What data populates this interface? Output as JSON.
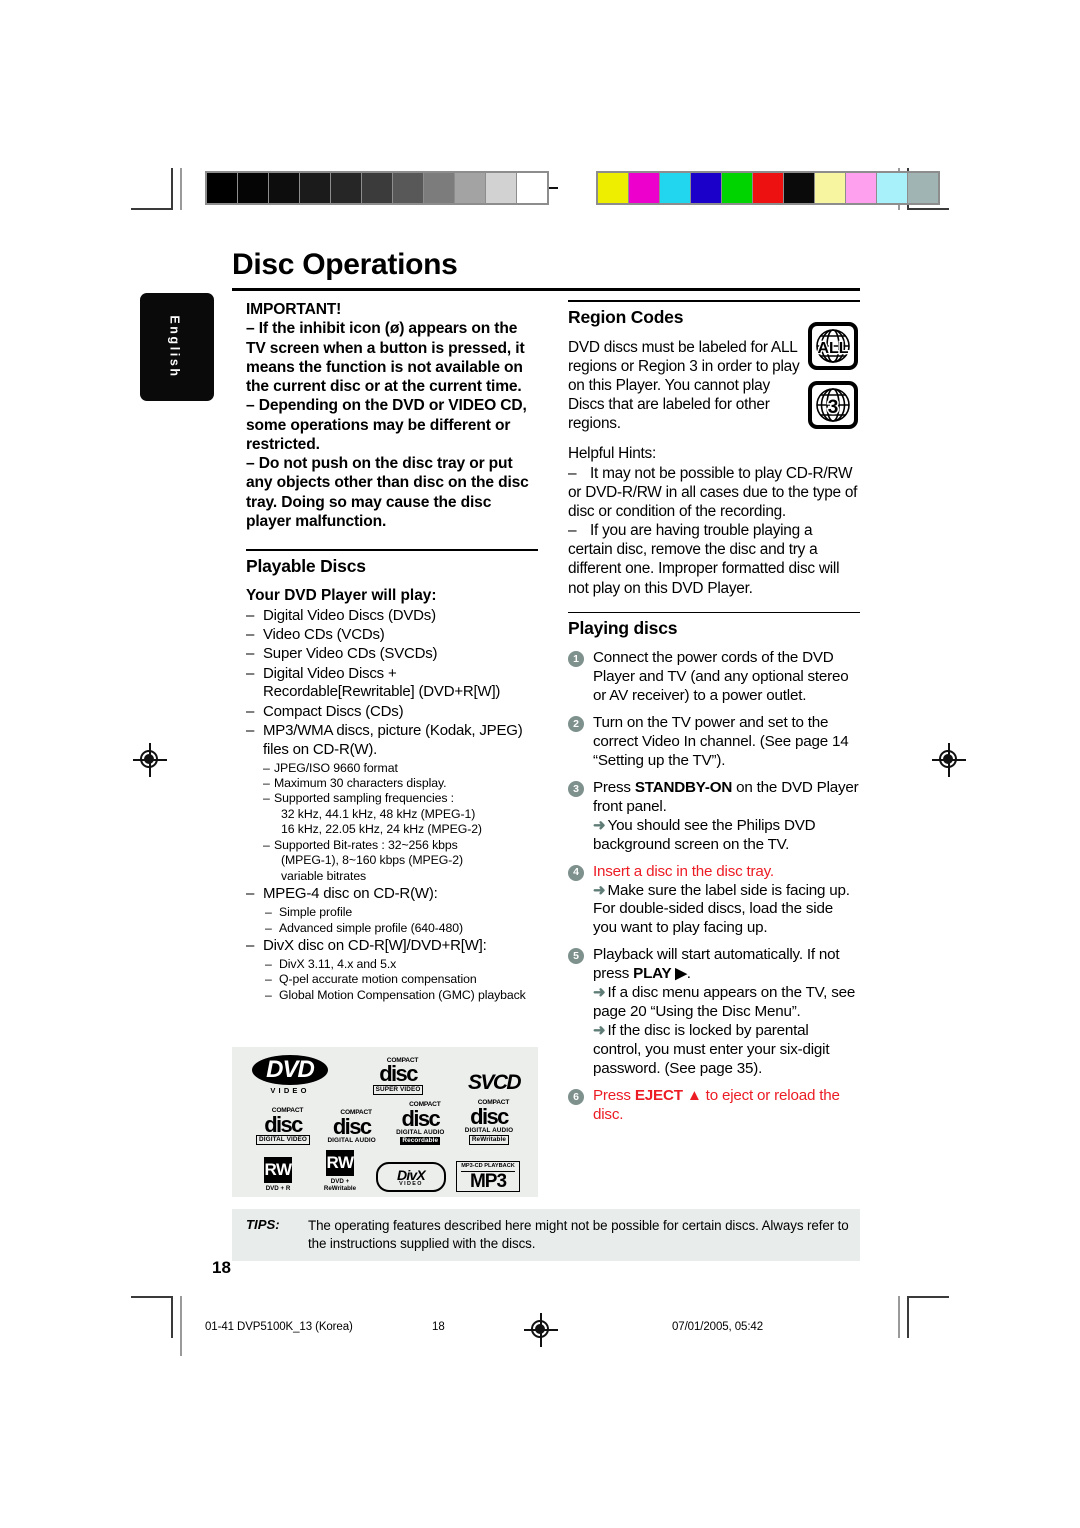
{
  "page": {
    "title": "Disc Operations",
    "number": "18",
    "language_tab": "English"
  },
  "color_bars": {
    "grayscale": [
      "#000000",
      "#050505",
      "#0d0d0d",
      "#1b1b1b",
      "#262626",
      "#3b3b3b",
      "#585858",
      "#7c7c7c",
      "#a3a3a3",
      "#d2d2d2",
      "#ffffff"
    ],
    "color": [
      "#eeee00",
      "#ee00cc",
      "#22d6f0",
      "#1a00c8",
      "#00d400",
      "#ee1111",
      "#0a0a0a",
      "#f7f5a0",
      "#ffa0ee",
      "#a8f0fa",
      "#a0b4b4"
    ]
  },
  "important": {
    "heading": "IMPORTANT!",
    "items": [
      "–  If the inhibit icon (ø) appears on the TV screen when a button is pressed, it means the function is not available on the current disc or at the current time.",
      "–  Depending on the DVD or VIDEO CD, some operations may be different or restricted.",
      "–  Do not push on the disc tray or put any objects other than disc on the disc tray.  Doing so may cause the disc player malfunction."
    ]
  },
  "playable_discs": {
    "heading": "Playable Discs",
    "subheading": "Your DVD Player will play:",
    "items": [
      {
        "text": "Digital Video Discs (DVDs)"
      },
      {
        "text": "Video CDs (VCDs)"
      },
      {
        "text": "Super Video CDs (SVCDs)"
      },
      {
        "text": "Digital Video Discs + Recordable[Rewritable] (DVD+R[W])"
      },
      {
        "text": "Compact Discs (CDs)"
      },
      {
        "text": "MP3/WMA discs, picture (Kodak, JPEG) files on CD-R(W).",
        "sub": [
          "JPEG/ISO 9660 format",
          "Maximum 30 characters display.",
          "Supported sampling frequencies :",
          "32 kHz, 44.1 kHz, 48 kHz (MPEG-1)",
          "16 kHz, 22.05 kHz, 24 kHz (MPEG-2)",
          "Supported Bit-rates : 32~256 kbps",
          "(MPEG-1), 8~160 kbps (MPEG-2)",
          "variable bitrates"
        ]
      },
      {
        "text": "MPEG-4 disc on CD-R(W):",
        "sub2": [
          "Simple profile",
          "Advanced simple profile (640-480)"
        ]
      },
      {
        "text": "DivX disc on CD-R[W]/DVD+R[W]:",
        "sub2": [
          "DivX 3.11, 4.x and 5.x",
          "Q-pel accurate motion compensation",
          "Global Motion Compensation (GMC) playback"
        ]
      }
    ]
  },
  "logos": {
    "dvd_video": {
      "main": "DVD",
      "sub": "VIDEO"
    },
    "cd_super_video": {
      "top": "COMPACT",
      "main": "disc",
      "sub": "SUPER VIDEO"
    },
    "svcd": {
      "main": "SVCD"
    },
    "cd_digital_video": {
      "top": "COMPACT",
      "main": "disc",
      "sub": "DIGITAL VIDEO"
    },
    "cd_digital_audio": {
      "top": "COMPACT",
      "main": "disc",
      "sub": "DIGITAL AUDIO"
    },
    "cd_recordable": {
      "top": "COMPACT",
      "main": "disc",
      "sub": "DIGITAL AUDIO",
      "sub2": "Recordable"
    },
    "cd_rewritable": {
      "top": "COMPACT",
      "main": "disc",
      "sub": "DIGITAL AUDIO",
      "sub2": "ReWritable"
    },
    "dvd_plus_r": {
      "main": "RW",
      "cap": "DVD + R"
    },
    "dvd_plus_rw": {
      "main": "RW",
      "cap": "DVD + ReWritable"
    },
    "divx": {
      "main": "DivX",
      "sub": "VIDEO"
    },
    "mp3": {
      "top": "MP3-CD PLAYBACK",
      "main": "MP3"
    }
  },
  "region_codes": {
    "heading": "Region Codes",
    "body": "DVD discs must be labeled for ALL regions or Region 3 in order to play on this Player. You cannot play Discs that are labeled for other regions.",
    "icon_all": "ALL",
    "icon_region": "3"
  },
  "helpful_hints": {
    "heading": "Helpful Hints:",
    "items": [
      "It may not be possible to play CD-R/RW or DVD-R/RW in all cases due to the type of disc or condition of the recording.",
      "If you are having trouble playing a certain disc, remove the disc and try a different one.  Improper formatted disc will not play on this DVD Player."
    ]
  },
  "playing_discs": {
    "heading": "Playing discs",
    "steps": [
      {
        "n": "1",
        "text": "Connect the power cords of the DVD Player and TV (and any optional stereo or AV receiver) to a power outlet.",
        "red": false,
        "notes": []
      },
      {
        "n": "2",
        "text": "Turn on the TV power and set to the correct Video In channel.  (See page 14 “Setting up the TV”).",
        "red": false,
        "notes": []
      },
      {
        "n": "3",
        "text_pre": "Press ",
        "text_bold": "STANDBY-ON",
        "text_post": " on the DVD Player front panel.",
        "red": false,
        "notes": [
          "You should see the Philips DVD background screen on the TV."
        ]
      },
      {
        "n": "4",
        "text": "Insert a disc in the disc tray.",
        "red": true,
        "notes": [
          "Make sure the label side is facing up. For double-sided discs, load the side you want to play facing up."
        ]
      },
      {
        "n": "5",
        "text_pre": "Playback will start automatically. If not press ",
        "text_bold": "PLAY ▶",
        "text_post": ".",
        "red": false,
        "notes": [
          "If a disc menu appears on the TV, see page 20 “Using the Disc Menu”.",
          "If the disc is locked by parental control, you must enter your six-digit password. (See page 35)."
        ]
      },
      {
        "n": "6",
        "text_pre": "Press ",
        "text_bold": "EJECT ▲",
        "text_post": " to eject or reload the disc.",
        "red": true,
        "notes": []
      }
    ]
  },
  "tips": {
    "label": "TIPS:",
    "text": "The operating features described here might not be possible for certain discs.  Always refer to the instructions supplied with the discs."
  },
  "footer": {
    "left": "01-41 DVP5100K_13 (Korea)",
    "page": "18",
    "right": "07/01/2005, 05:42"
  },
  "colors": {
    "step_badge": "#7e918d",
    "arrow": "#5f7d76",
    "red": "#ec1c24",
    "tips_bg": "#e8edeb",
    "logo_panel_bg": "#eceeec"
  }
}
